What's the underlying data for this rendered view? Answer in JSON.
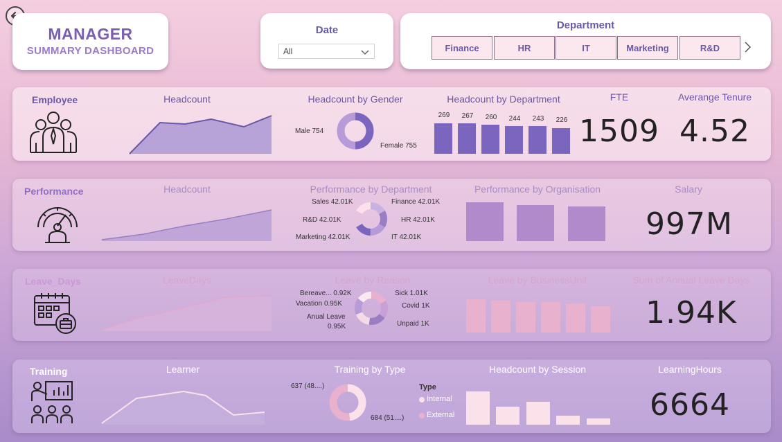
{
  "header": {
    "title_main": "MANAGER",
    "title_sub": "SUMMARY DASHBOARD",
    "date_label": "Date",
    "date_value": "All",
    "department_label": "Department",
    "departments": [
      "Finance",
      "HR",
      "IT",
      "Marketing",
      "R&D"
    ]
  },
  "employee": {
    "label": "Employee",
    "headcount_title": "Headcount",
    "gender_title": "Headcount by Gender",
    "gender_male": "Male 754",
    "gender_female": "Female 755",
    "dept_title": "Headcount by Department",
    "dept_values": [
      "269",
      "267",
      "260",
      "244",
      "243",
      "226"
    ],
    "fte_title": "FTE",
    "fte_value": "1509",
    "tenure_title": "Averange Tenure",
    "tenure_value": "4.52"
  },
  "performance": {
    "label": "Performance",
    "headcount_title": "Headcount",
    "dept_title": "Performance by Department",
    "sales": "Sales 42.01K",
    "finance": "Finance 42.01K",
    "rd": "R&D 42.01K",
    "hr": "HR 42.01K",
    "marketing": "Marketing 42.01K",
    "it": "IT 42.01K",
    "org_title": "Performance by Organisation",
    "salary_title": "Salary",
    "salary_value": "997M"
  },
  "leave": {
    "label": "Leave_Days",
    "days_title": "LeaveDays",
    "reason_title": "Leave by Reason",
    "bereave": "Bereave... 0.92K",
    "sick": "Sick 1.01K",
    "vacation": "Vacation 0.95K",
    "covid": "Covid 1K",
    "anual_1": "Anual Leave",
    "anual_2": "0.95K",
    "unpaid": "Unpaid 1K",
    "bu_title": "Leave by BusinessUnit",
    "sum_title": "Sum of Annual Leave Days",
    "sum_value": "1.94K"
  },
  "training": {
    "label": "Training",
    "learner_title": "Learner",
    "type_title": "Training by Type",
    "internal_val": "637 (48....)",
    "external_val": "684 (51....)",
    "legend_title": "Type",
    "legend_internal": "Internal",
    "legend_external": "External",
    "session_title": "Headcount by Session",
    "hours_title": "LearningHours",
    "hours_value": "6664"
  },
  "colors": {
    "accent": "#6a58a8",
    "bar_purple": "#7a66bf",
    "perf_bar": "#b08acb",
    "leave_bar": "#e8b2cf",
    "training_bar": "#fbe2ea"
  }
}
